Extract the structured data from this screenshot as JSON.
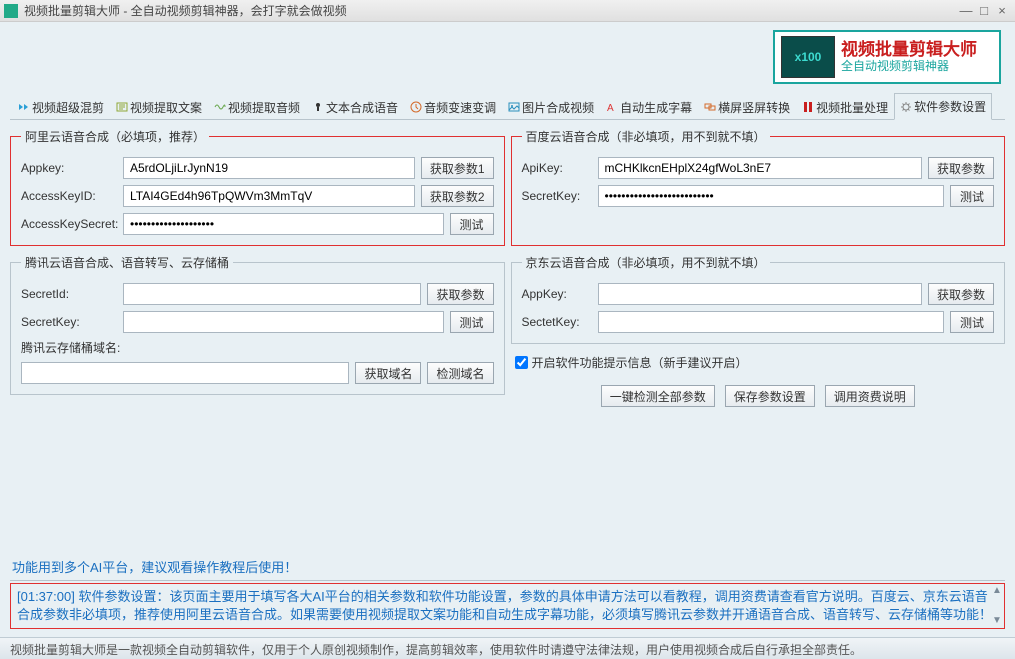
{
  "window": {
    "title": "视频批量剪辑大师 - 全自动视频剪辑神器，会打字就会做视频"
  },
  "banner": {
    "badge": "x100",
    "line1": "视频批量剪辑大师",
    "line2": "全自动视频剪辑神器"
  },
  "tabs": [
    {
      "label": "视频超级混剪",
      "color": "#2a9fd6"
    },
    {
      "label": "视频提取文案",
      "color": "#8fa838"
    },
    {
      "label": "视频提取音频",
      "color": "#6aa84f"
    },
    {
      "label": "文本合成语音",
      "color": "#333"
    },
    {
      "label": "音频变速变调",
      "color": "#d46a2a"
    },
    {
      "label": "图片合成视频",
      "color": "#2a8fbd"
    },
    {
      "label": "自动生成字幕",
      "color": "#d33"
    },
    {
      "label": "横屏竖屏转换",
      "color": "#d46a2a"
    },
    {
      "label": "视频批量处理",
      "color": "#c91f1f"
    },
    {
      "label": "软件参数设置",
      "color": "#888"
    }
  ],
  "activeTab": 9,
  "ali": {
    "legend": "阿里云语音合成（必填项，推荐）",
    "appkey_label": "Appkey:",
    "appkey_value": "A5rdOLjiLrJynN19",
    "appkey_btn": "获取参数1",
    "akid_label": "AccessKeyID:",
    "akid_value": "LTAI4GEd4h96TpQWVm3MmTqV",
    "akid_btn": "获取参数2",
    "aks_label": "AccessKeySecret:",
    "aks_value": "********************",
    "aks_btn": "测试"
  },
  "baidu": {
    "legend": "百度云语音合成（非必填项，用不到就不填）",
    "apikey_label": "ApiKey:",
    "apikey_value": "mCHKlkcnEHplX24gfWoL3nE7",
    "apikey_btn": "获取参数",
    "sk_label": "SecretKey:",
    "sk_value": "**************************",
    "sk_btn": "测试"
  },
  "tencent": {
    "legend": "腾讯云语音合成、语音转写、云存储桶",
    "sid_label": "SecretId:",
    "sid_value": "",
    "sid_btn": "获取参数",
    "sk_label": "SecretKey:",
    "sk_value": "",
    "sk_btn": "测试",
    "bucket_label": "腾讯云存储桶域名:",
    "bucket_value": "",
    "bucket_btn1": "获取域名",
    "bucket_btn2": "检测域名"
  },
  "jd": {
    "legend": "京东云语音合成（非必填项，用不到就不填）",
    "ak_label": "AppKey:",
    "ak_value": "",
    "ak_btn": "获取参数",
    "sk_label": "SectetKey:",
    "sk_value": "",
    "sk_btn": "测试"
  },
  "tips": {
    "checkbox_label": "开启软件功能提示信息（新手建议开启）",
    "checked": true
  },
  "actions": {
    "btn1": "一键检测全部参数",
    "btn2": "保存参数设置",
    "btn3": "调用资费说明"
  },
  "log": {
    "line1": "功能用到多个AI平台，建议观看操作教程后使用！",
    "ts": "[01:37:00]",
    "msg": " 软件参数设置：该页面主要用于填写各大AI平台的相关参数和软件功能设置，参数的具体申请方法可以看教程，调用资费请查看官方说明。百度云、京东云语音合成参数非必填项，推荐使用阿里云语音合成。如果需要使用视频提取文案功能和自动生成字幕功能，必须填写腾讯云参数并开通语音合成、语音转写、云存储桶等功能！"
  },
  "footer": "视频批量剪辑大师是一款视频全自动剪辑软件，仅用于个人原创视频制作，提高剪辑效率，使用软件时请遵守法律法规，用户使用视频合成后自行承担全部责任。"
}
